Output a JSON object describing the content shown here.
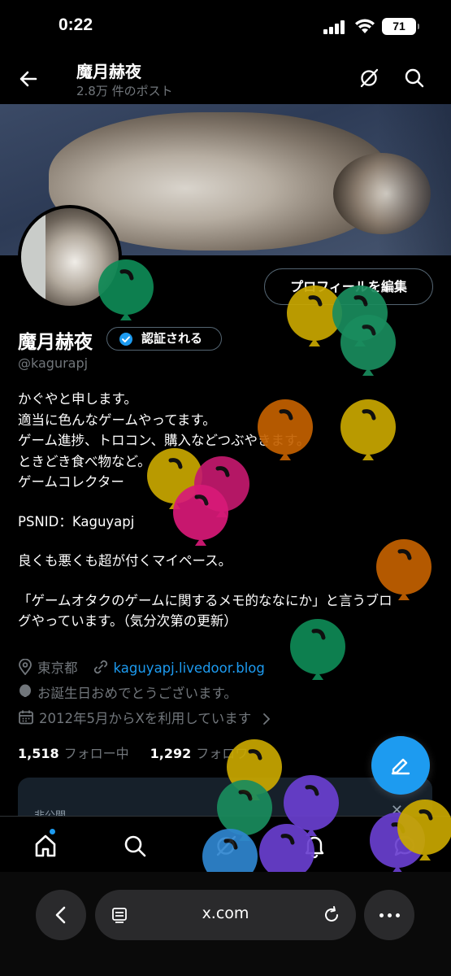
{
  "status_bar": {
    "time": "0:22",
    "battery": "71"
  },
  "header": {
    "title": "魔月赫夜",
    "subtitle": "2.8万 件のポスト"
  },
  "profile": {
    "edit_button": "プロフィールを編集",
    "display_name": "魔月赫夜",
    "verify_button": "認証される",
    "handle": "@kagurapj",
    "bio_lines": [
      "かぐやと申します。",
      "適当に色んなゲームやってます。",
      "ゲーム進捗、トロコン、購入などつぶやきます。",
      "ときどき食べ物など。",
      "ゲームコレクター",
      "",
      "PSNID：Kaguyapj",
      "",
      "良くも悪くも超が付くマイペース。",
      "",
      "「ゲームオタクのゲームに関するメモ的ななにか」と言うブロ",
      "グやっています。（気分次第の更新）"
    ],
    "location": "東京都",
    "website": "kaguyapj.livedoor.blog",
    "birthday": "お誕生日おめでとうございます。",
    "joined": "2012年5月からXを利用しています",
    "following_count": "1,518",
    "following_label": "フォロー中",
    "followers_count": "1,292",
    "followers_label": "フォロワー"
  },
  "private_card": {
    "label": "非公開"
  },
  "browser": {
    "url": "x.com"
  },
  "colors": {
    "accent": "#1d9bf0",
    "muted": "#71767b",
    "background": "#000000"
  },
  "balloons": [
    {
      "color": "#0f8a56"
    },
    {
      "color": "#c9a800"
    },
    {
      "color": "#1a8c5e"
    },
    {
      "color": "#1a8c5e"
    },
    {
      "color": "#c46100"
    },
    {
      "color": "#c9a800"
    },
    {
      "color": "#c9a800"
    },
    {
      "color": "#c41a6e"
    },
    {
      "color": "#d81a78"
    },
    {
      "color": "#c46100"
    },
    {
      "color": "#0f8a56"
    },
    {
      "color": "#c9a800"
    },
    {
      "color": "#1a8c5e"
    },
    {
      "color": "#6a3fd0"
    },
    {
      "color": "#2f86d0"
    },
    {
      "color": "#6a3fd0"
    },
    {
      "color": "#6a3fd0"
    },
    {
      "color": "#c9a800"
    }
  ]
}
